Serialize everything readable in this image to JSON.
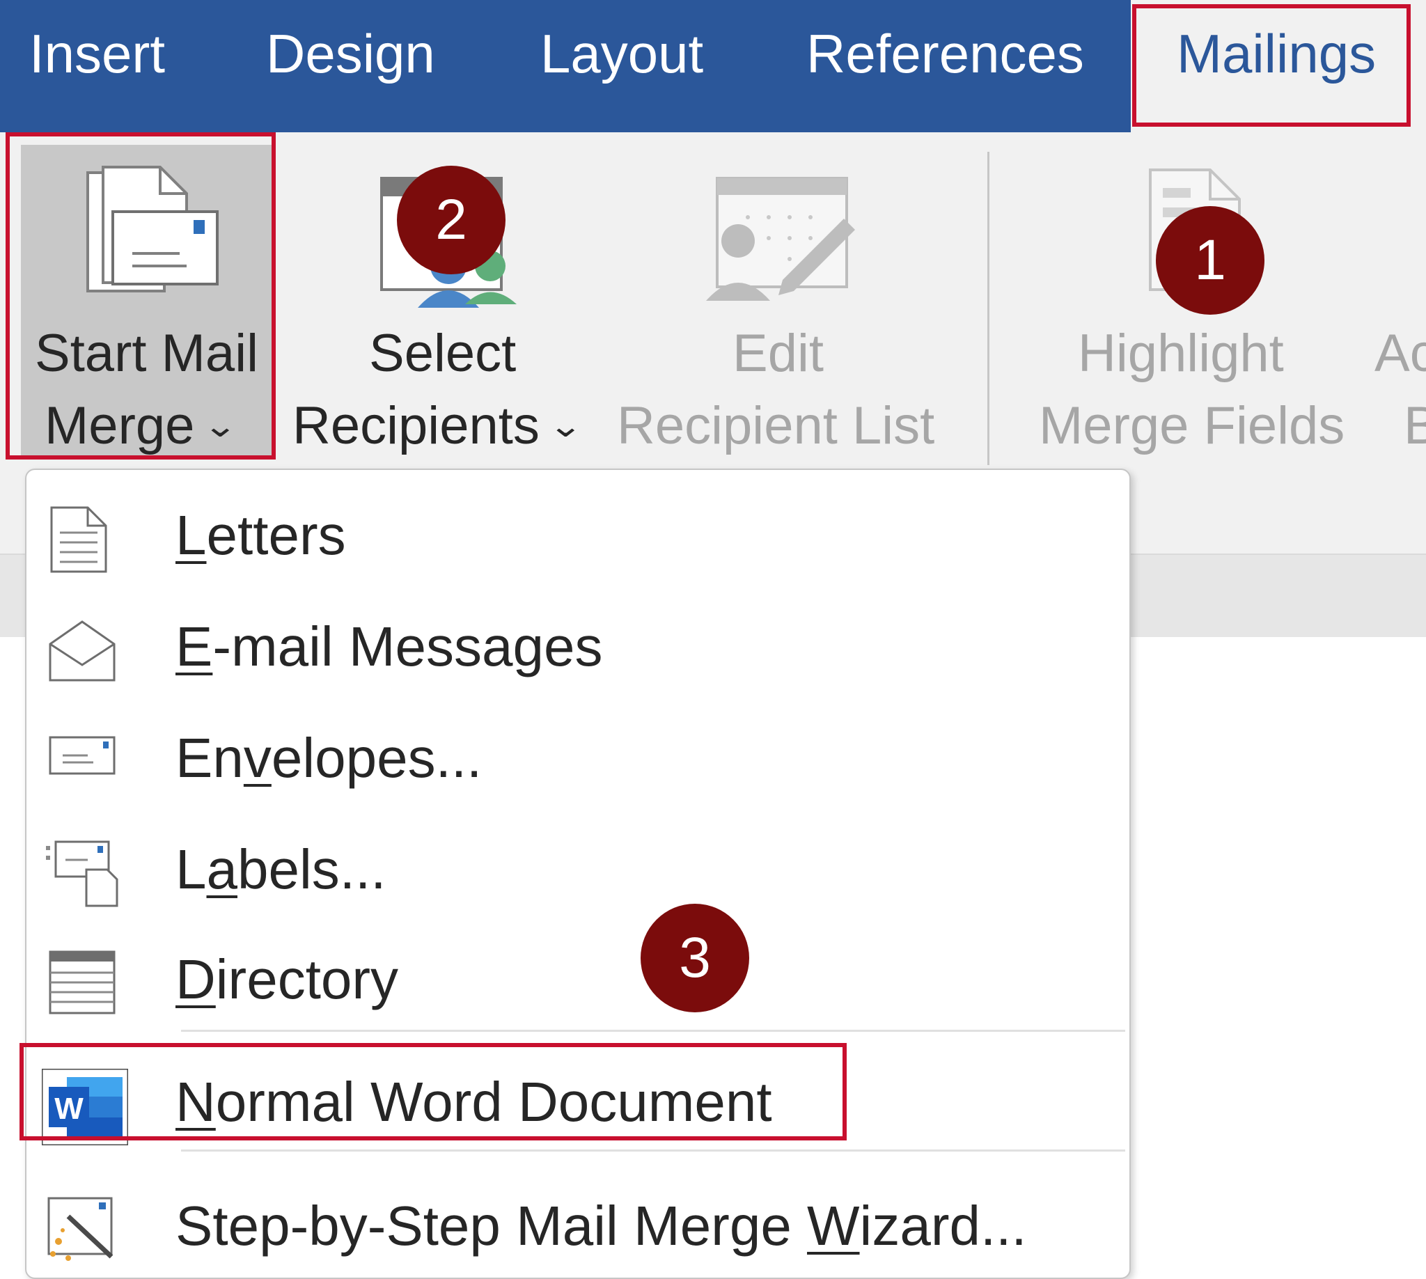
{
  "tabs": [
    {
      "label": "Insert"
    },
    {
      "label": "Design"
    },
    {
      "label": "Layout"
    },
    {
      "label": "References"
    },
    {
      "label": "Mailings",
      "active": true
    }
  ],
  "ribbon": {
    "start_mail_merge": {
      "line1": "Start Mail",
      "line2": "Merge",
      "chevron": "⌄"
    },
    "select_recipients": {
      "line1": "Select",
      "line2": "Recipients",
      "chevron": "⌄"
    },
    "edit_recipient_list": {
      "line1": "Edit",
      "line2": "Recipient List",
      "enabled": false
    },
    "highlight_merge_fields": {
      "line1": "Highlight",
      "line2": "Merge Fields",
      "enabled": false
    },
    "cut_off_button": {
      "line1": "Ac",
      "line2": "B"
    }
  },
  "menu": {
    "items": [
      {
        "pre": "",
        "u": "L",
        "post": "etters",
        "icon": "document-icon"
      },
      {
        "pre": "",
        "u": "E",
        "post": "-mail Messages",
        "icon": "open-envelope-icon"
      },
      {
        "pre": "En",
        "u": "v",
        "post": "elopes...",
        "icon": "envelope-icon"
      },
      {
        "pre": "L",
        "u": "a",
        "post": "bels...",
        "icon": "labels-icon"
      },
      {
        "pre": "",
        "u": "D",
        "post": "irectory",
        "icon": "directory-icon"
      },
      {
        "pre": "",
        "u": "N",
        "post": "ormal Word Document",
        "icon": "word-icon"
      },
      {
        "pre": "Step-by-Step Mail Merge ",
        "u": "W",
        "post": "izard...",
        "icon": "wizard-icon"
      }
    ]
  },
  "annotations": {
    "badges": [
      "1",
      "2",
      "3"
    ],
    "highlight_color": "#c8102e",
    "badge_color": "#7b0c0c"
  },
  "colors": {
    "tabbar": "#2b579a",
    "ribbon": "#f1f1f1"
  }
}
